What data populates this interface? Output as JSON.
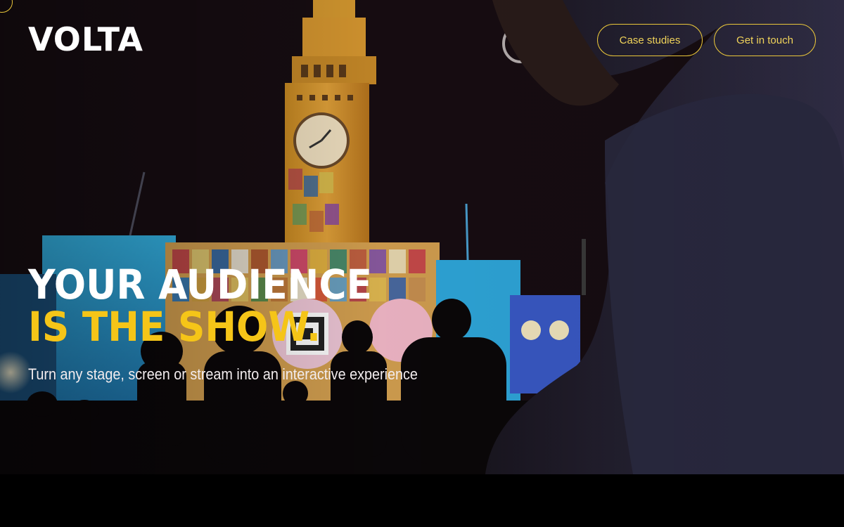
{
  "brand": {
    "logo_text": "VOLTA"
  },
  "nav": {
    "case_studies_label": "Case studies",
    "get_in_touch_label": "Get in touch"
  },
  "hero": {
    "headline_line1": "YOUR AUDIENCE",
    "headline_line2": "IS THE SHOW.",
    "subheadline": "Turn any stage, screen or stream into an interactive experience"
  },
  "colors": {
    "accent": "#f5c518",
    "button_border": "#e9c63a",
    "text_primary": "#ffffff",
    "background": "#000000"
  }
}
